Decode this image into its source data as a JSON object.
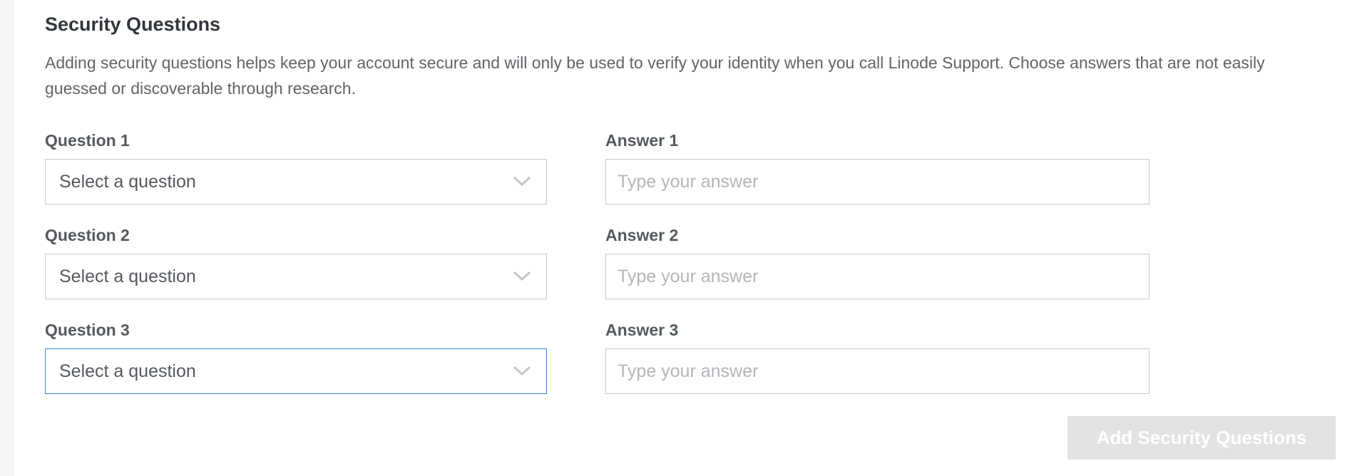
{
  "section": {
    "title": "Security Questions",
    "description": "Adding security questions helps keep your account secure and will only be used to verify your identity when you call Linode Support. Choose answers that are not easily guessed or discoverable through research."
  },
  "questions": [
    {
      "label": "Question 1",
      "value": "Select a question"
    },
    {
      "label": "Question 2",
      "value": "Select a question"
    },
    {
      "label": "Question 3",
      "value": "Select a question"
    }
  ],
  "answers": [
    {
      "label": "Answer 1",
      "placeholder": "Type your answer"
    },
    {
      "label": "Answer 2",
      "placeholder": "Type your answer"
    },
    {
      "label": "Answer 3",
      "placeholder": "Type your answer"
    }
  ],
  "submit_label": "Add Security Questions",
  "icons": {
    "select_chevron": "chevron-down-icon"
  },
  "colors": {
    "focus_border": "#3683dc",
    "disabled_button": "#e2e3e5",
    "heading": "#32363c"
  }
}
